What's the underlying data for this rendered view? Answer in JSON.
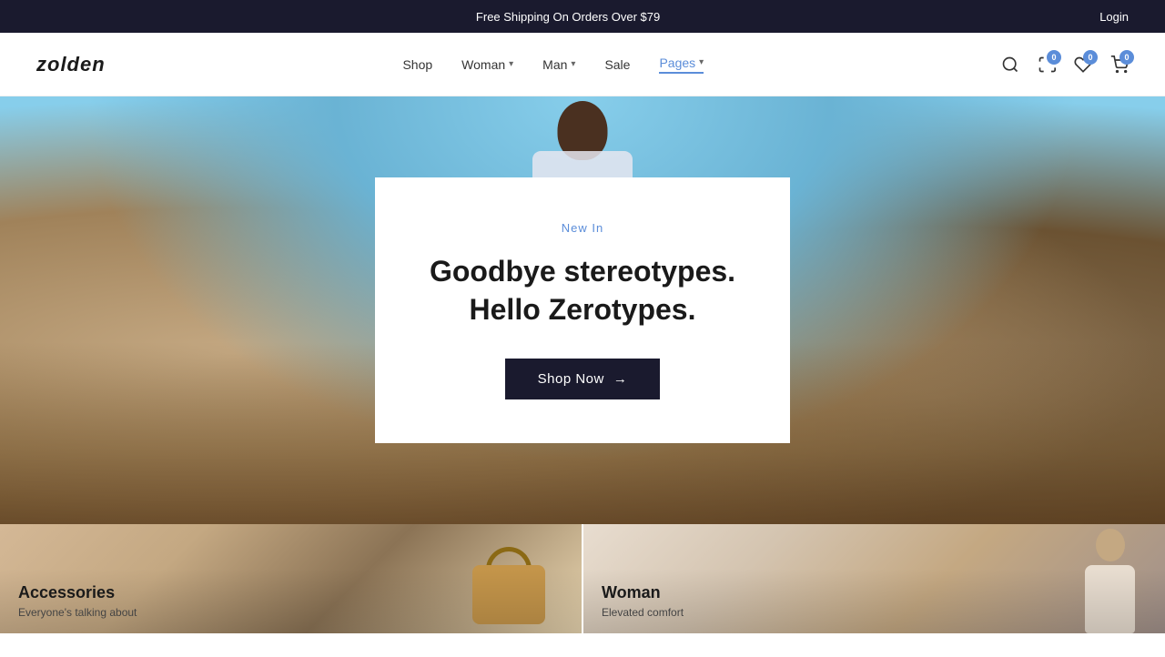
{
  "topBar": {
    "shipping_text": "Free Shipping On Orders Over $79",
    "login_label": "Login"
  },
  "header": {
    "logo": "zolden",
    "nav": [
      {
        "label": "Shop",
        "has_dropdown": false
      },
      {
        "label": "Woman",
        "has_dropdown": true
      },
      {
        "label": "Man",
        "has_dropdown": true
      },
      {
        "label": "Sale",
        "has_dropdown": false
      },
      {
        "label": "Pages",
        "has_dropdown": true,
        "active": true
      }
    ],
    "icons": {
      "search": "search-icon",
      "compare_badge": "0",
      "wishlist_badge": "0",
      "cart_badge": "0"
    }
  },
  "hero": {
    "tag": "New In",
    "title_line1": "Goodbye stereotypes.",
    "title_line2": "Hello Zerotypes.",
    "cta_label": "Shop Now",
    "cta_arrow": "→"
  },
  "categories": [
    {
      "title": "Accessories",
      "subtitle": "Everyone's talking about"
    },
    {
      "title": "Woman",
      "subtitle": "Elevated comfort"
    }
  ]
}
